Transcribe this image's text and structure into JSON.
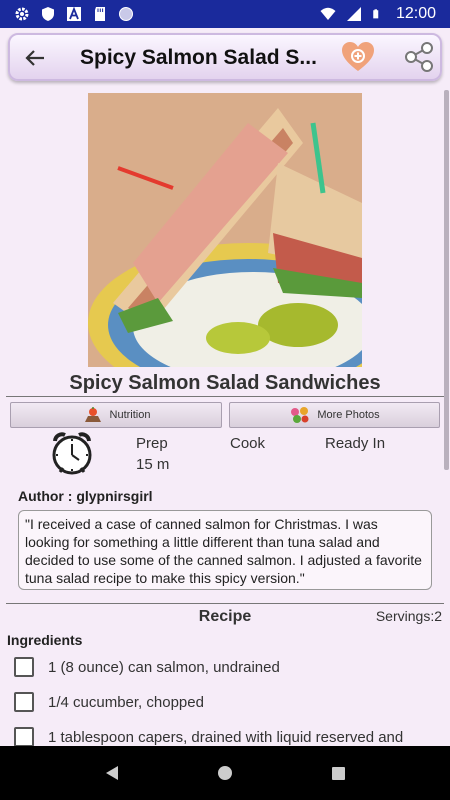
{
  "status": {
    "time": "12:00"
  },
  "appbar": {
    "title": "Spicy Salmon Salad S..."
  },
  "recipe": {
    "title": "Spicy Salmon Salad Sandwiches",
    "buttons": {
      "nutrition": "Nutrition",
      "more_photos": "More Photos"
    },
    "times": {
      "prep_label": "Prep",
      "prep_value": "15 m",
      "cook_label": "Cook",
      "ready_label": "Ready In"
    },
    "author": "Author : glypnirsgirl",
    "description": "\"I received a case of canned salmon for Christmas. I was looking for something a little different than tuna salad and decided to use some of the canned salmon. I adjusted a favorite tuna salad recipe to make this spicy version.\"",
    "section_title": "Recipe",
    "servings": "Servings:2",
    "ingredients_header": "Ingredients",
    "ingredients": [
      "1 (8 ounce) can salmon, undrained",
      "1/4 cucumber, chopped",
      "1 tablespoon capers, drained with liquid reserved and"
    ]
  },
  "icons": {
    "status_left": [
      "gear-icon",
      "shield-icon",
      "a-icon",
      "sd-card-icon",
      "circle-icon"
    ],
    "status_right": [
      "wifi-icon",
      "signal-icon",
      "battery-icon"
    ],
    "appbar": [
      "back-arrow-icon",
      "favorite-heart-icon",
      "share-icon"
    ],
    "buttons": [
      "scale-icon",
      "photos-icon"
    ],
    "timer": "alarm-clock-icon"
  },
  "colors": {
    "status_bar": "#1a2a9c",
    "background": "#f6ecf8",
    "heart": "#f0a27a"
  }
}
